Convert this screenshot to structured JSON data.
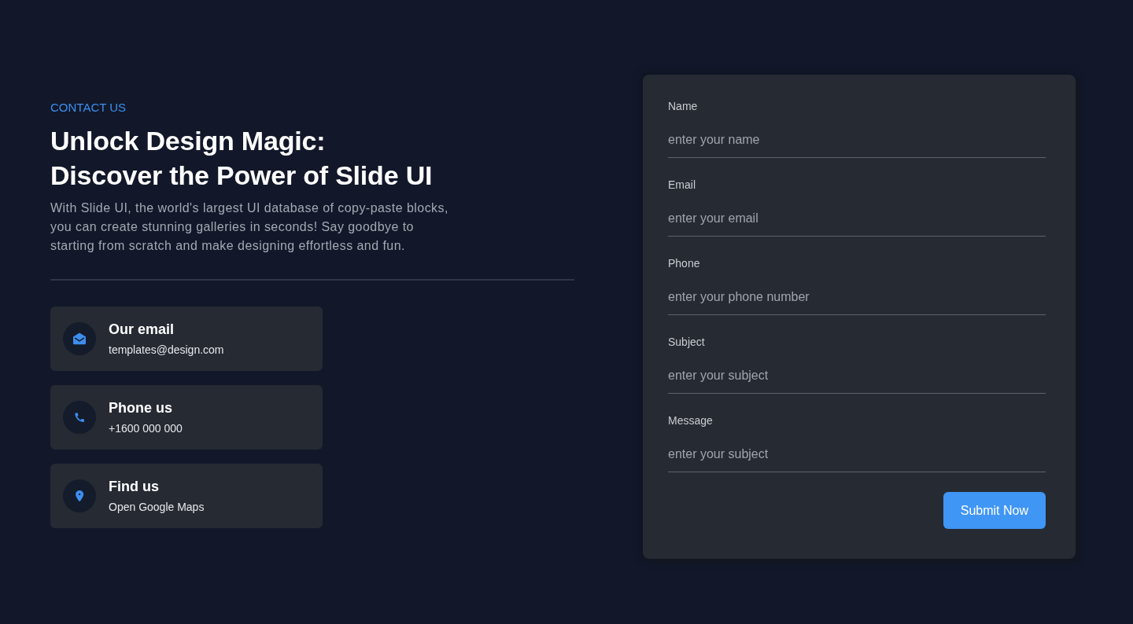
{
  "eyebrow": "CONTACT US",
  "heading_lines": [
    "Unlock Design Magic:",
    "Discover the Power of Slide UI"
  ],
  "description": "With Slide UI, the world's largest UI database of copy-paste blocks, you can create stunning galleries in seconds! Say goodbye to starting from scratch and make designing effortless and fun.",
  "contacts": [
    {
      "kind": "email",
      "title": "Our email",
      "detail": "templates@design.com"
    },
    {
      "kind": "phone",
      "title": "Phone us",
      "detail": "+1600 000 000"
    },
    {
      "kind": "location",
      "title": "Find us",
      "detail": "Open Google Maps"
    }
  ],
  "form": {
    "fields": [
      {
        "label": "Name",
        "placeholder": "enter your name"
      },
      {
        "label": "Email",
        "placeholder": "enter your email"
      },
      {
        "label": "Phone",
        "placeholder": "enter your phone number"
      },
      {
        "label": "Subject",
        "placeholder": "enter your subject"
      },
      {
        "label": "Message",
        "placeholder": "enter your subject"
      }
    ],
    "submit": "Submit Now"
  }
}
